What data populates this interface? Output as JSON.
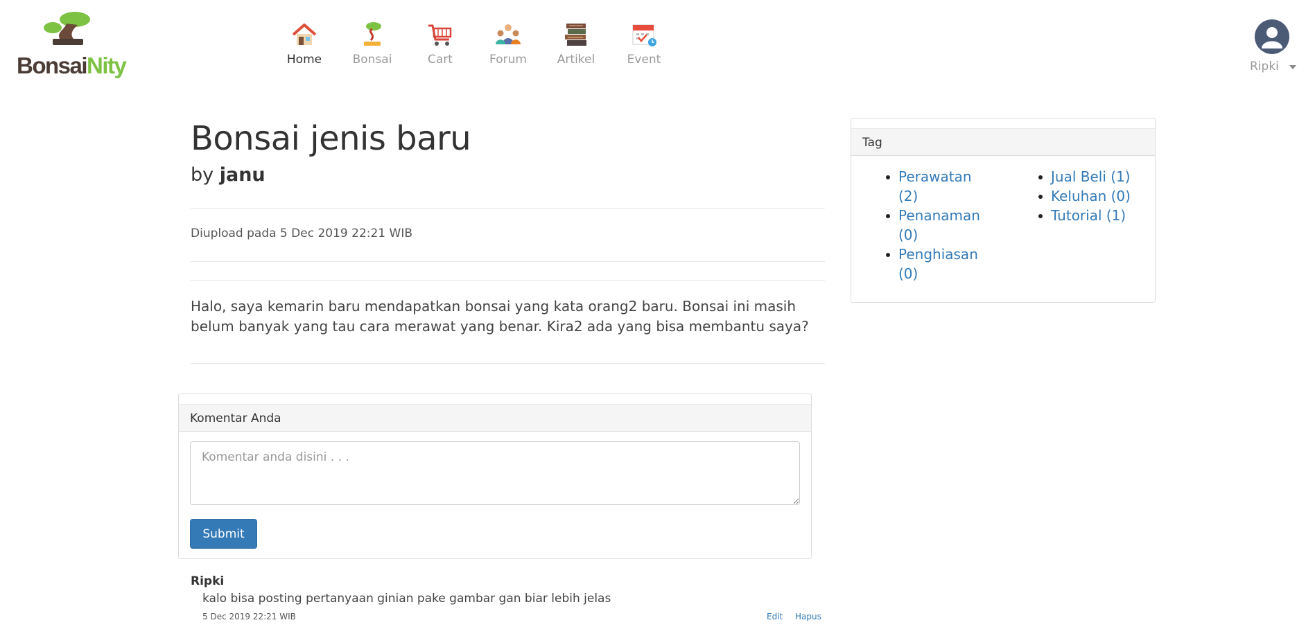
{
  "brand": {
    "name_part1": "Bonsai",
    "name_part2": "Nity"
  },
  "nav": {
    "items": [
      {
        "label": "Home",
        "icon": "home-icon",
        "active": true
      },
      {
        "label": "Bonsai",
        "icon": "bonsai-icon",
        "active": false
      },
      {
        "label": "Cart",
        "icon": "cart-icon",
        "active": false
      },
      {
        "label": "Forum",
        "icon": "forum-icon",
        "active": false
      },
      {
        "label": "Artikel",
        "icon": "books-icon",
        "active": false
      },
      {
        "label": "Event",
        "icon": "calendar-icon",
        "active": false
      }
    ]
  },
  "user": {
    "name": "Ripki",
    "avatar_icon": "user-avatar-icon"
  },
  "post": {
    "title": "Bonsai jenis baru",
    "by_prefix": "by",
    "author": "janu",
    "uploaded": "Diupload pada 5 Dec 2019 22:21 WIB",
    "body": "Halo, saya kemarin baru mendapatkan bonsai yang kata orang2 baru. Bonsai ini masih belum banyak yang tau cara merawat yang benar. Kira2 ada yang bisa membantu saya?"
  },
  "comment_form": {
    "heading": "Komentar Anda",
    "placeholder": "Komentar anda disini . . .",
    "value": "",
    "submit_label": "Submit"
  },
  "comments": [
    {
      "author": "Ripki",
      "text": "kalo bisa posting pertanyaan ginian pake gambar gan biar lebih jelas",
      "date": "5 Dec 2019 22:21 WIB",
      "edit_label": "Edit",
      "delete_label": "Hapus"
    }
  ],
  "tags": {
    "heading": "Tag",
    "left": [
      "Perawatan (2)",
      "Penanaman (0)",
      "Penghiasan (0)"
    ],
    "right": [
      "Jual Beli (1)",
      "Keluhan (0)",
      "Tutorial (1)"
    ]
  },
  "colors": {
    "link": "#337ab7",
    "brand_dark": "#4a3c35",
    "brand_green": "#7dc242",
    "avatar_bg": "#4b5a75"
  }
}
